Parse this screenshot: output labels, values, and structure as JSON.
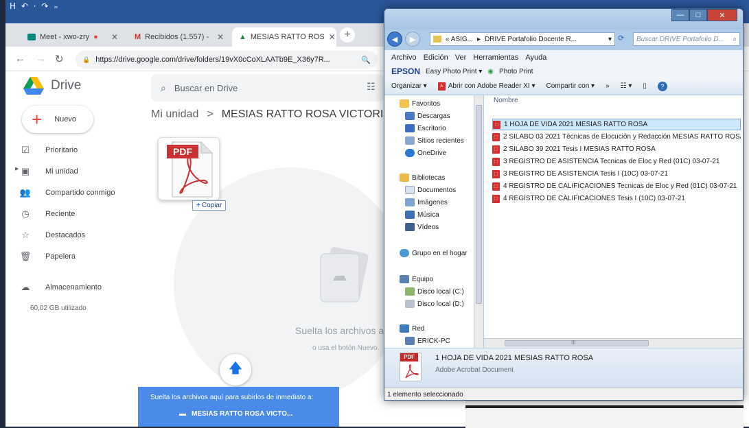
{
  "qat": "H  ↶ · ↷ ₌",
  "chrome": {
    "tabs": [
      {
        "label": "Meet - xwo-zry",
        "icon": "meet-icon"
      },
      {
        "label": "Recibidos (1.557) -",
        "icon": "gmail-icon"
      },
      {
        "label": "MESIAS RATTO ROS",
        "icon": "drive-icon"
      }
    ],
    "url": "https://drive.google.com/drive/folders/19vX0cCoXLAATb9E_X36y7R..."
  },
  "drive": {
    "logo_text": "Drive",
    "search_placeholder": "Buscar en Drive",
    "new_label": "Nuevo",
    "nav": [
      {
        "label": "Prioritario",
        "icon": "☑"
      },
      {
        "label": "Mi unidad",
        "icon": "▣"
      },
      {
        "label": "Compartido conmigo",
        "icon": "👥"
      },
      {
        "label": "Reciente",
        "icon": "◷"
      },
      {
        "label": "Destacados",
        "icon": "☆"
      },
      {
        "label": "Papelera",
        "icon": "🗑"
      }
    ],
    "storage_label": "Almacenamiento",
    "storage_used": "60,02 GB utilizado",
    "breadcrumb_root": "Mi unidad",
    "breadcrumb_sep": ">",
    "breadcrumb_current": "MESIAS RATTO ROSA VICTORIA",
    "drag_badge": "PDF",
    "copy_label": "Copiar",
    "drop_title": "Suelta los archivos a",
    "drop_sub": "o usa el botón Nuevo.",
    "upload_line1": "Suelta los archivos aquí para subirlos de inmediato a:",
    "upload_folder": "MESIAS RATTO ROSA VICTO..."
  },
  "explorer": {
    "path": [
      "«  ASIG...",
      "▸",
      "DRIVE Portafolio Docente R..."
    ],
    "search_placeholder": "Buscar DRIVE Portafolio D...",
    "menu": [
      "Archivo",
      "Edición",
      "Ver",
      "Herramientas",
      "Ayuda"
    ],
    "epson_brand": "EPSON",
    "epson_items": [
      "Easy Photo Print ▾",
      "Photo Print"
    ],
    "commands": [
      "Organizar ▾",
      "Abrir con Adobe Reader XI ▾",
      "Compartir con ▾",
      "»"
    ],
    "column_name": "Nombre",
    "tree": [
      {
        "label": "Favoritos",
        "color": "#f2c14e",
        "indent": 0
      },
      {
        "label": "Descargas",
        "color": "#4a78c4",
        "indent": 1
      },
      {
        "label": "Escritorio",
        "color": "#3b6cc0",
        "indent": 1
      },
      {
        "label": "Sitios recientes",
        "color": "#8aa7cf",
        "indent": 1
      },
      {
        "label": "OneDrive",
        "color": "#2b78d0",
        "indent": 1
      },
      {
        "label": "Bibliotecas",
        "color": "#e9b949",
        "indent": 0
      },
      {
        "label": "Documentos",
        "color": "#d9e2ef",
        "indent": 1
      },
      {
        "label": "Imágenes",
        "color": "#7fa3cf",
        "indent": 1
      },
      {
        "label": "Música",
        "color": "#3d6fb4",
        "indent": 1
      },
      {
        "label": "Vídeos",
        "color": "#3f5e8a",
        "indent": 1
      },
      {
        "label": "Grupo en el hogar",
        "color": "#4c9bd8",
        "indent": 0
      },
      {
        "label": "Equipo",
        "color": "#5a7fb0",
        "indent": 0
      },
      {
        "label": "Disco local (C:)",
        "color": "#8fb36a",
        "indent": 1
      },
      {
        "label": "Disco local (D:)",
        "color": "#b8c2cf",
        "indent": 1
      },
      {
        "label": "Red",
        "color": "#3f79c0",
        "indent": 0
      },
      {
        "label": "ERICK-PC",
        "color": "#5a7fb0",
        "indent": 1
      }
    ],
    "files": [
      "1 HOJA DE VIDA 2021 MESIAS RATTO ROSA",
      "2 SILABO 03 2021 Técnicas de Elocución y Redacción MESIAS RATTO ROSA",
      "2 SILABO 39 2021 Tesis I  MESIAS RATTO ROSA",
      "3 REGISTRO DE ASISTENCIA  Tecnicas de Eloc y Red (01C) 03-07-21",
      "3 REGISTRO DE ASISTENCIA  Tesis I  (10C) 03-07-21",
      "4 REGISTRO DE CALIFICACIONES  Tecnicas de Eloc y Red (01C) 03-07-21",
      "4 REGISTRO DE CALIFICACIONES Tesis I  (10C) 03-07-21"
    ],
    "selected_index": 0,
    "detail_badge": "PDF",
    "detail_name": "1 HOJA DE VIDA 2021 MESIAS RATTO ROSA",
    "detail_type": "Adobe Acrobat Document",
    "status": "1 elemento seleccionado",
    "scroll_mark": "III"
  }
}
